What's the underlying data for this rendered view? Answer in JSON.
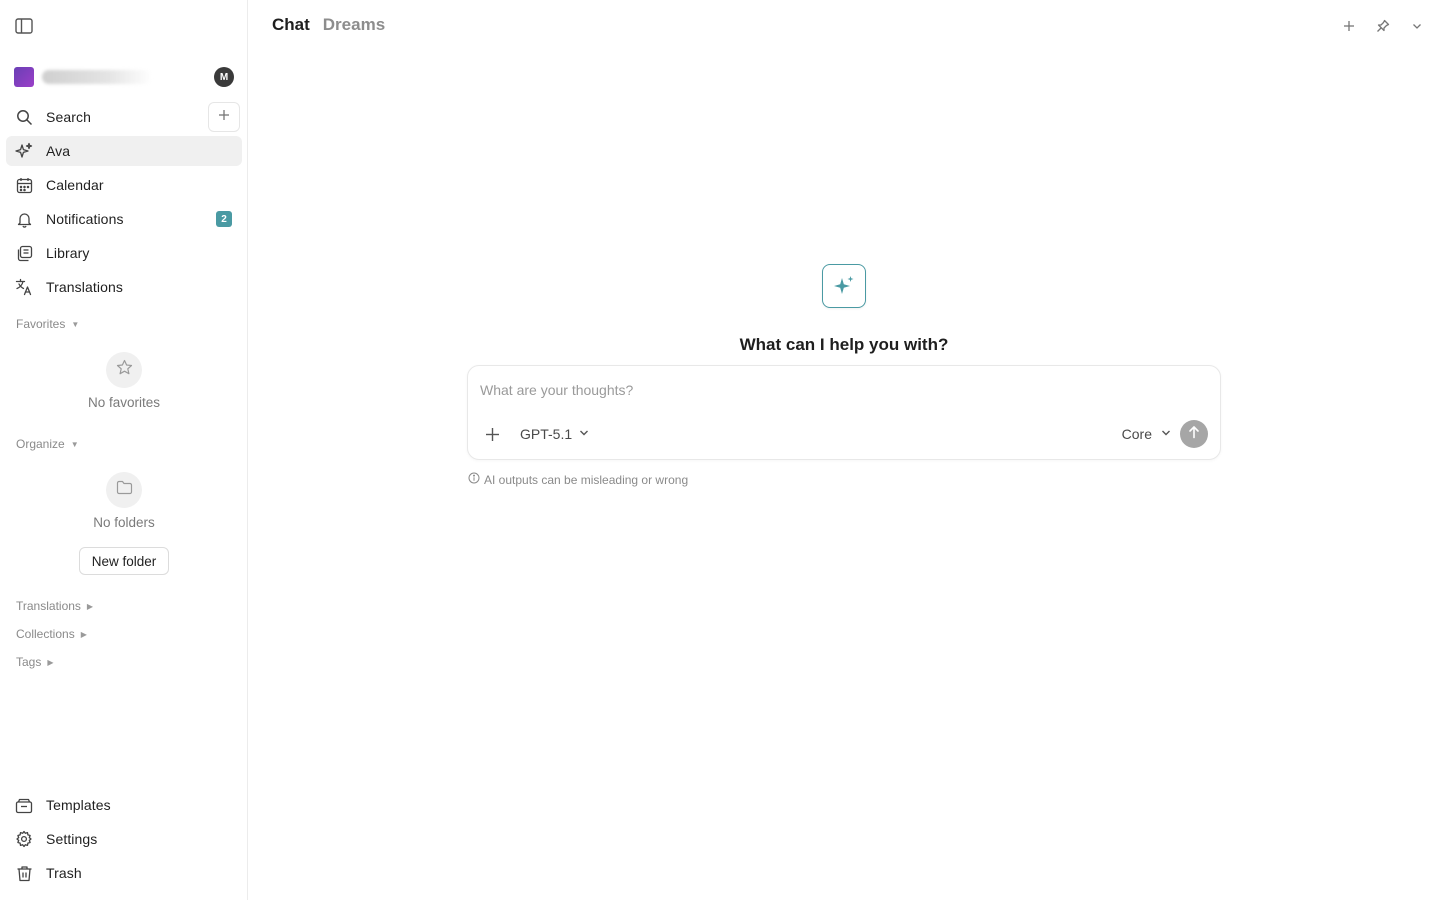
{
  "sidebar": {
    "avatar_initial": "M",
    "search_label": "Search",
    "nav": [
      {
        "label": "Ava",
        "icon": "sparkles-icon",
        "active": true
      },
      {
        "label": "Calendar",
        "icon": "calendar-icon"
      },
      {
        "label": "Notifications",
        "icon": "bell-icon",
        "badge": "2"
      },
      {
        "label": "Library",
        "icon": "library-icon"
      },
      {
        "label": "Translations",
        "icon": "translate-icon"
      }
    ],
    "favorites": {
      "heading": "Favorites",
      "empty_text": "No favorites"
    },
    "organize": {
      "heading": "Organize",
      "empty_text": "No folders",
      "new_folder_label": "New folder"
    },
    "sections": [
      "Translations",
      "Collections",
      "Tags"
    ],
    "bottom": [
      {
        "label": "Templates",
        "icon": "templates-icon"
      },
      {
        "label": "Settings",
        "icon": "gear-icon"
      },
      {
        "label": "Trash",
        "icon": "trash-icon"
      }
    ]
  },
  "header": {
    "tabs": [
      {
        "label": "Chat",
        "active": true
      },
      {
        "label": "Dreams",
        "active": false
      }
    ]
  },
  "main": {
    "title": "What can I help you with?",
    "composer": {
      "placeholder": "What are your thoughts?",
      "model": "GPT-5.1",
      "mode": "Core"
    },
    "disclaimer": "AI outputs can be misleading or wrong"
  },
  "colors": {
    "accent": "#4a9aa3",
    "badge": "#4a9aa3",
    "workspace_logo": "#7b3fbf",
    "send_button": "#a6a6a6"
  }
}
